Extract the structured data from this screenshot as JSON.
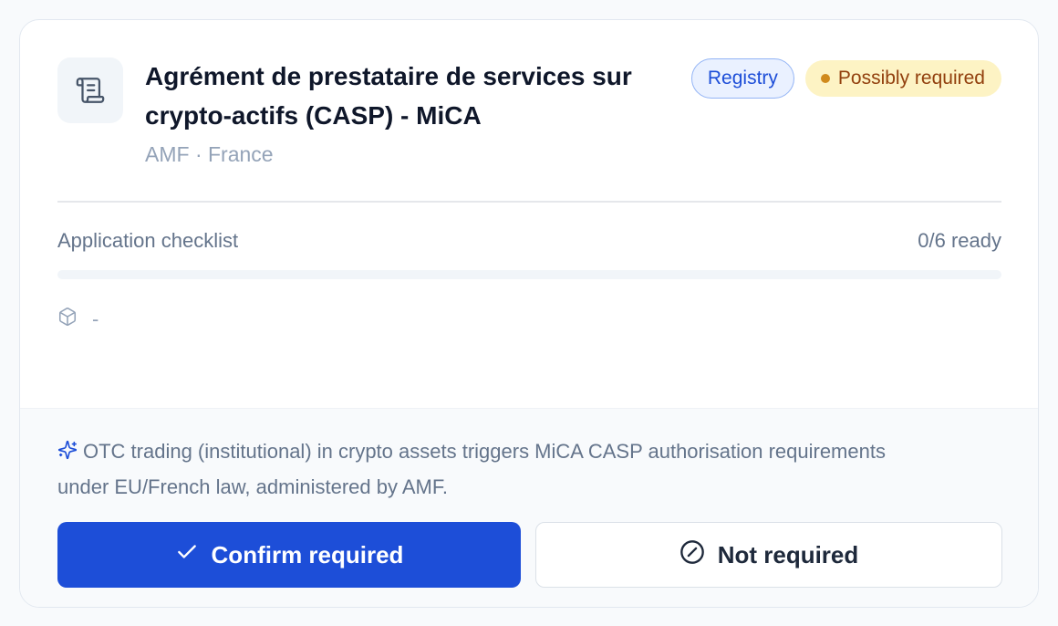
{
  "permit": {
    "title": "Agrément de prestataire de services sur crypto-actifs (CASP) - MiCA",
    "meta": "AMF · France",
    "icon": "scroll-icon",
    "badges": {
      "registry": "Registry",
      "status": "Possibly required"
    }
  },
  "checklist": {
    "label": "Application checklist",
    "count": "0/6 ready",
    "progress": 0,
    "item_icon": "box-icon",
    "item_text": "-"
  },
  "reason": {
    "icon": "sparkle-icon",
    "text": "OTC trading (institutional) in crypto assets triggers MiCA CASP authorisation requirements under EU/French law, administered by AMF."
  },
  "actions": {
    "confirm_label": "Confirm required",
    "confirm_icon": "check-icon",
    "not_required_label": "Not required",
    "not_required_icon": "ban-icon"
  },
  "colors": {
    "primary": "#1d4ed8",
    "registry_bg": "#eaf1ff",
    "status_bg": "#fdf3c4",
    "status_text": "#92400e"
  }
}
